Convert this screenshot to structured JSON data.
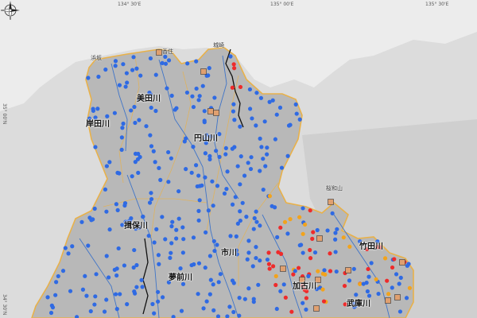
{
  "map": {
    "graticule": {
      "top": [
        "134° 30'E",
        "135° 00'E",
        "135° 30'E"
      ],
      "left": [
        "35° 00'N",
        "34° 30'N"
      ]
    },
    "compass": {
      "icon": "north-arrow-icon"
    },
    "labels": {
      "river_1": "美田川",
      "river_2": "岸田川",
      "river_3": "円山川",
      "river_4": "揖保川",
      "river_5": "市川",
      "river_6": "夢前川",
      "river_7": "加古川",
      "river_8": "竹田川",
      "river_9": "武庫川",
      "mountain_1": "桜和山",
      "town_1": "浜坂",
      "town_2": "香住",
      "town_3": "城崎"
    },
    "colors": {
      "sea": "#dcdcdc",
      "land": "#c4c4c4",
      "prefecture_fill": "#b9b9b9",
      "prefecture_border": "#e8b14a",
      "river": "#3f74c8",
      "border_line": "#111111",
      "point_blue": "#2f6ae3",
      "point_red": "#ee2b2b",
      "point_orange": "#f2a31c",
      "point_dark": "#7a1f2a"
    }
  }
}
